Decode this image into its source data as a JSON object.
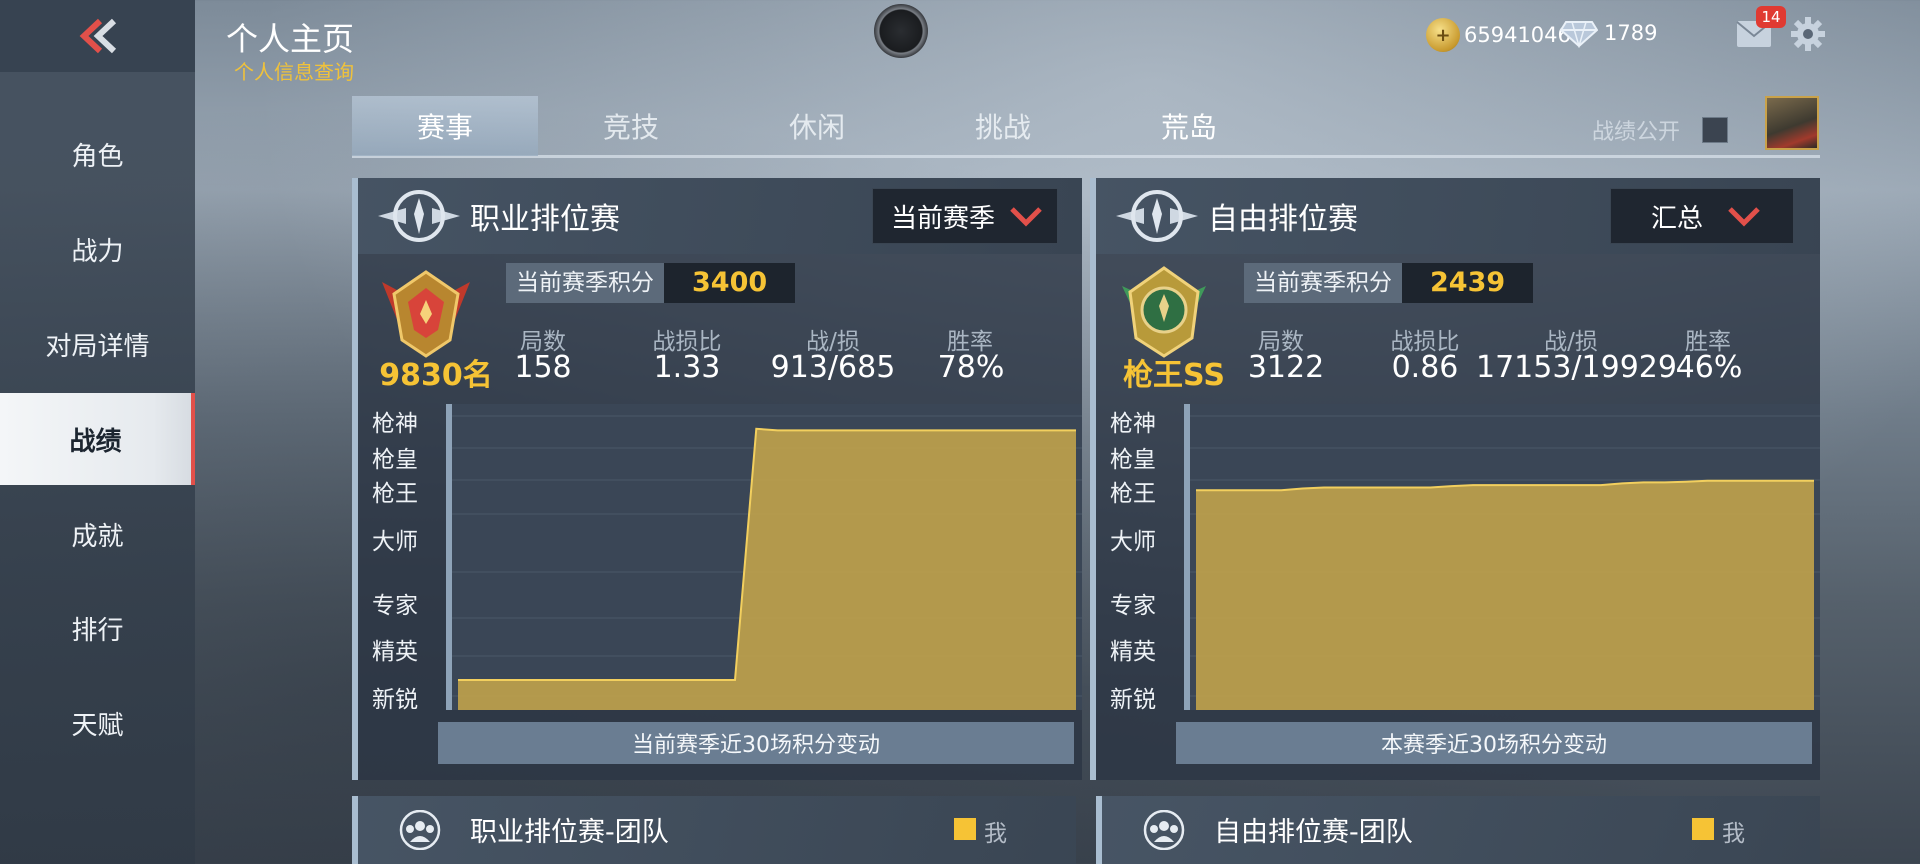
{
  "header": {
    "title": "个人主页",
    "subtitle": "个人信息查询",
    "coins": "65941046",
    "diamonds": "1789",
    "mail_count": "14"
  },
  "sidebar": {
    "items": [
      {
        "label": "角色"
      },
      {
        "label": "战力"
      },
      {
        "label": "对局详情"
      },
      {
        "label": "战绩",
        "active": true
      },
      {
        "label": "成就"
      },
      {
        "label": "排行"
      },
      {
        "label": "天赋"
      }
    ]
  },
  "tabs": [
    {
      "label": "赛事",
      "active": true
    },
    {
      "label": "竞技"
    },
    {
      "label": "休闲"
    },
    {
      "label": "挑战"
    },
    {
      "label": "荒岛"
    }
  ],
  "public_toggle": {
    "label": "战绩公开",
    "checked": false
  },
  "panels": [
    {
      "title": "职业排位赛",
      "dropdown": "当前赛季",
      "rank_text": "9830名",
      "season_label": "当前赛季积分",
      "season_value": "3400",
      "stats": [
        {
          "label": "局数",
          "value": "158"
        },
        {
          "label": "战损比",
          "value": "1.33"
        },
        {
          "label": "战/损",
          "value": "913/685"
        },
        {
          "label": "胜率",
          "value": "78%"
        }
      ],
      "tiers": [
        "枪神",
        "枪皇",
        "枪王",
        "大师",
        "专家",
        "精英",
        "新锐"
      ],
      "caption": "当前赛季近30场积分变动"
    },
    {
      "title": "自由排位赛",
      "dropdown": "汇总",
      "rank_text": "枪王SS",
      "season_label": "当前赛季积分",
      "season_value": "2439",
      "stats": [
        {
          "label": "局数",
          "value": "3122"
        },
        {
          "label": "战损比",
          "value": "0.86"
        },
        {
          "label": "战/损",
          "value": "17153/19929"
        },
        {
          "label": "胜率",
          "value": "46%"
        }
      ],
      "tiers": [
        "枪神",
        "枪皇",
        "枪王",
        "大师",
        "专家",
        "精英",
        "新锐"
      ],
      "caption": "本赛季近30场积分变动"
    }
  ],
  "team_panels": [
    {
      "title": "职业排位赛-团队",
      "legend": "我"
    },
    {
      "title": "自由排位赛-团队",
      "legend": "我"
    }
  ],
  "chart_data": [
    {
      "type": "area",
      "title": "当前赛季近30场积分变动",
      "y_tiers": [
        "新锐",
        "精英",
        "专家",
        "大师",
        "枪王",
        "枪皇",
        "枪神"
      ],
      "y_unit": "tier index (0=新锐 … 6=枪神)",
      "series": [
        {
          "values": [
            0.4,
            0.4,
            0.4,
            0.4,
            0.4,
            0.4,
            0.4,
            0.4,
            0.4,
            0.4,
            0.4,
            0.4,
            0.4,
            0.4,
            6.6,
            6.55,
            6.55,
            6.55,
            6.55,
            6.55,
            6.55,
            6.55,
            6.55,
            6.55,
            6.55,
            6.55,
            6.55,
            6.55,
            6.55,
            6.55
          ]
        }
      ],
      "color": "#c9a84a"
    },
    {
      "type": "area",
      "title": "本赛季近30场积分变动",
      "y_tiers": [
        "新锐",
        "精英",
        "专家",
        "大师",
        "枪王",
        "枪皇",
        "枪神"
      ],
      "y_unit": "tier index (0=新锐 … 6=枪神)",
      "series": [
        {
          "values": [
            4.7,
            4.7,
            4.7,
            4.7,
            4.7,
            4.75,
            4.78,
            4.78,
            4.78,
            4.78,
            4.78,
            4.78,
            4.82,
            4.85,
            4.85,
            4.85,
            4.85,
            4.85,
            4.85,
            4.85,
            4.9,
            4.93,
            4.93,
            4.95,
            4.98,
            4.98,
            4.98,
            4.98,
            4.98,
            4.98
          ]
        }
      ],
      "color": "#c9a84a"
    }
  ]
}
